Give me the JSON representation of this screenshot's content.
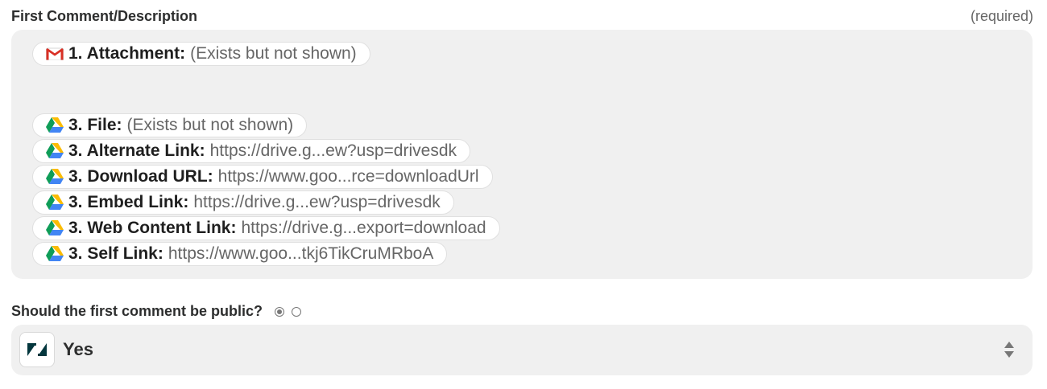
{
  "comment_field": {
    "label": "First Comment/Description",
    "required": "(required)",
    "tokens": [
      {
        "icon": "gmail-icon",
        "key": "1. Attachment:",
        "value": "(Exists but not shown)"
      },
      {
        "icon": "google-drive-icon",
        "key": "3. File:",
        "value": "(Exists but not shown)"
      },
      {
        "icon": "google-drive-icon",
        "key": "3. Alternate Link:",
        "value": "https://drive.g...ew?usp=drivesdk"
      },
      {
        "icon": "google-drive-icon",
        "key": "3. Download URL:",
        "value": "https://www.goo...rce=downloadUrl"
      },
      {
        "icon": "google-drive-icon",
        "key": "3. Embed Link:",
        "value": "https://drive.g...ew?usp=drivesdk"
      },
      {
        "icon": "google-drive-icon",
        "key": "3. Web Content Link:",
        "value": "https://drive.g...export=download"
      },
      {
        "icon": "google-drive-icon",
        "key": "3. Self Link:",
        "value": "https://www.goo...tkj6TikCruMRboA"
      }
    ]
  },
  "public_field": {
    "label": "Should the first comment be public?",
    "radio_selected": "on",
    "selected_value": "Yes",
    "app_icon": "zendesk-icon"
  },
  "colors": {
    "field_bg": "#f0f0f0",
    "pill_bg": "#ffffff",
    "zendesk": "#03363d"
  }
}
